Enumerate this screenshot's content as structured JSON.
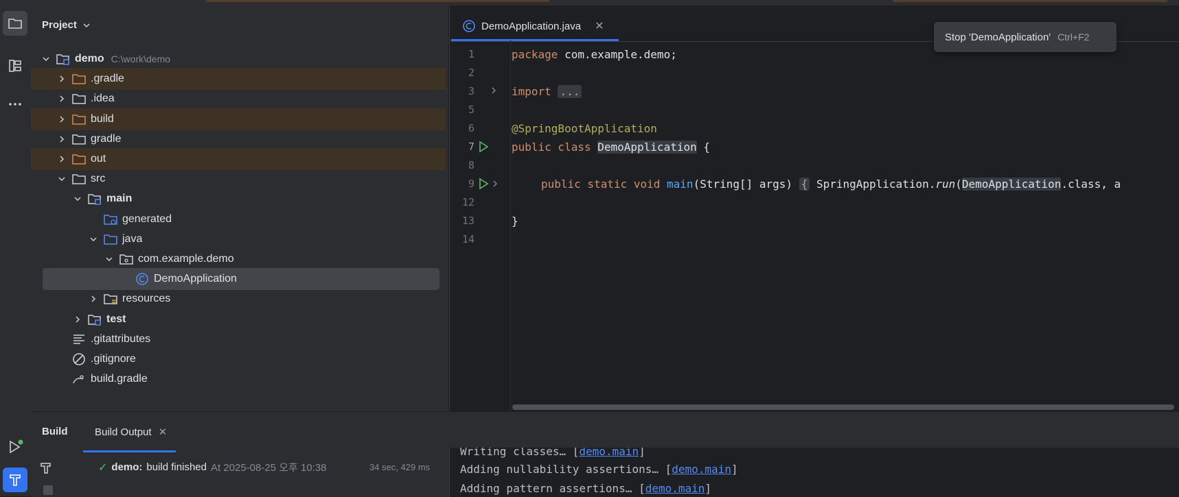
{
  "colors": {
    "accent": "#3574f0",
    "excluded_bg": "#3d3224",
    "selected_bg": "#43454a",
    "success": "#5fb865",
    "run_green": "#5fb865"
  },
  "project": {
    "title": "Project",
    "tree": [
      {
        "label": "demo",
        "path": "C:\\work\\demo",
        "icon": "module-folder-icon",
        "expanded": true,
        "bold": true
      },
      {
        "label": ".gradle",
        "icon": "excluded-folder-icon",
        "excluded": true
      },
      {
        "label": ".idea",
        "icon": "folder-icon"
      },
      {
        "label": "build",
        "icon": "excluded-folder-icon",
        "excluded": true
      },
      {
        "label": "gradle",
        "icon": "folder-icon"
      },
      {
        "label": "out",
        "icon": "excluded-folder-icon",
        "excluded": true
      },
      {
        "label": "src",
        "icon": "folder-icon",
        "expanded": true
      },
      {
        "label": "main",
        "icon": "module-folder-icon",
        "expanded": true,
        "bold": true
      },
      {
        "label": "generated",
        "icon": "generated-sources-folder-icon"
      },
      {
        "label": "java",
        "icon": "source-folder-icon",
        "expanded": true
      },
      {
        "label": "com.example.demo",
        "icon": "package-icon",
        "expanded": true
      },
      {
        "label": "DemoApplication",
        "icon": "spring-boot-class-icon",
        "selected": true
      },
      {
        "label": "resources",
        "icon": "resources-folder-icon"
      },
      {
        "label": "test",
        "icon": "module-folder-icon",
        "bold": true
      },
      {
        "label": ".gitattributes",
        "icon": "text-file-icon"
      },
      {
        "label": ".gitignore",
        "icon": "gitignore-icon"
      },
      {
        "label": "build.gradle",
        "icon": "gradle-file-icon"
      }
    ]
  },
  "editor": {
    "tab_label": "DemoApplication.java",
    "tooltip": {
      "text": "Stop 'DemoApplication'",
      "shortcut": "Ctrl+F2"
    },
    "line_numbers": [
      "1",
      "2",
      "3",
      "5",
      "6",
      "7",
      "8",
      "9",
      "12",
      "13",
      "14"
    ],
    "code": {
      "l1_kw": "package",
      "l1_rest": " com.example.demo;",
      "l3_kw": "import",
      "l3_fold": "...",
      "l6_annotation": "@SpringBootApplication",
      "l7_kw": "public class",
      "l7_class": "DemoApplication",
      "l7_rest": " {",
      "l9_kw": "public static void",
      "l9_fn": "main",
      "l9_params": "(String[] args) ",
      "l9_brace": "{",
      "l9_call": " SpringApplication.",
      "l9_run": "run",
      "l9_paren": "(",
      "l9_cls": "DemoApplication",
      "l9_tail": ".class, a",
      "l13": "}"
    }
  },
  "build": {
    "title": "Build",
    "output_tab": "Build Output",
    "status_name": "demo:",
    "status_text": "build finished",
    "status_time": "At 2025-08-25 오후 10:38",
    "status_duration": "34 sec, 429 ms",
    "output_lines": [
      {
        "text": "Writing classes… [",
        "link": "demo.main",
        "end": "]"
      },
      {
        "text": "Adding nullability assertions… [",
        "link": "demo.main",
        "end": "]"
      },
      {
        "text": "Adding pattern assertions… [",
        "link": "demo.main",
        "end": "]"
      }
    ]
  }
}
